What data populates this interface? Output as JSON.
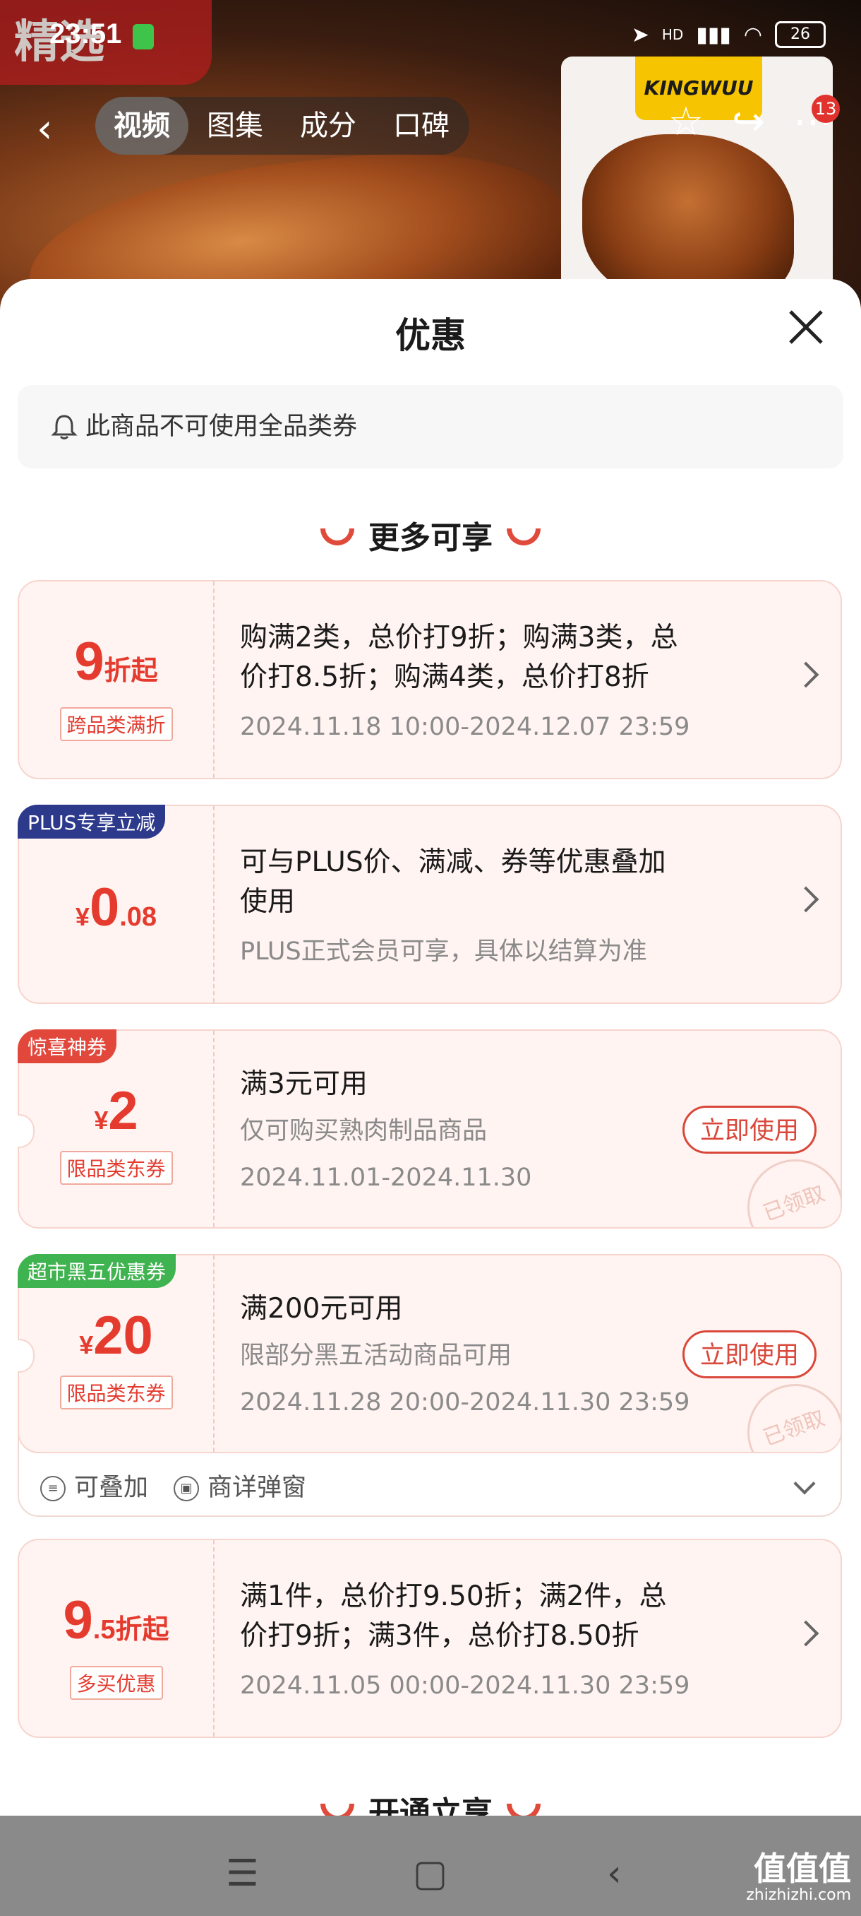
{
  "status_bar": {
    "time": "23:51",
    "network": "HD",
    "battery": "26"
  },
  "top_nav": {
    "tabs": [
      "视频",
      "图集",
      "成分",
      "口碑"
    ],
    "active_tab": 0,
    "cart_badge": "13"
  },
  "background": {
    "brand_label": "KINGWUU",
    "overlay_label": "精选"
  },
  "sheet": {
    "title": "优惠",
    "notice": "此商品不可使用全品类券",
    "section_more": "更多可享",
    "section_open": "开通立享"
  },
  "cards": [
    {
      "big_main": "9",
      "big_suffix": "折起",
      "tag": "跨品类满折",
      "line1": "购满2类，总价打9折；购满3类，总",
      "line2": "价打8.5折；购满4类，总价打8折",
      "date": "2024.11.18 10:00-2024.12.07 23:59"
    },
    {
      "ribbon": "PLUS专享立减",
      "ribbon_color": "#2d3a8c",
      "currency": "¥",
      "big_main": "0",
      "big_suffix": ".08",
      "line1": "可与PLUS价、满减、券等优惠叠加",
      "line2": "使用",
      "note": "PLUS正式会员可享，具体以结算为准"
    },
    {
      "ribbon": "惊喜神券",
      "ribbon_color": "#e2473c",
      "currency": "¥",
      "big_main": "2",
      "tag": "限品类东券",
      "line1": "满3元可用",
      "note": "仅可购买熟肉制品商品",
      "date": "2024.11.01-2024.11.30",
      "button": "立即使用",
      "stamp": "已领取"
    },
    {
      "ribbon": "超市黑五优惠券",
      "ribbon_color": "#3fb34f",
      "currency": "¥",
      "big_main": "20",
      "tag": "限品类东券",
      "line1": "满200元可用",
      "note": "限部分黑五活动商品可用",
      "date": "2024.11.28 20:00-2024.11.30 23:59",
      "button": "立即使用",
      "stamp": "已领取",
      "footer_1": "可叠加",
      "footer_2": "商详弹窗"
    },
    {
      "big_main": "9",
      "big_suffix": ".5折起",
      "tag": "多买优惠",
      "line1": "满1件，总价打9.50折；满2件，总",
      "line2": "价打9折；满3件，总价打8.50折",
      "date": "2024.11.05 00:00-2024.11.30 23:59"
    }
  ],
  "watermark": {
    "main": "值值值",
    "sub": "zhizhizhi.com"
  },
  "colors": {
    "accent_red": "#e53b2f",
    "card_bg": "#fff4f1"
  }
}
